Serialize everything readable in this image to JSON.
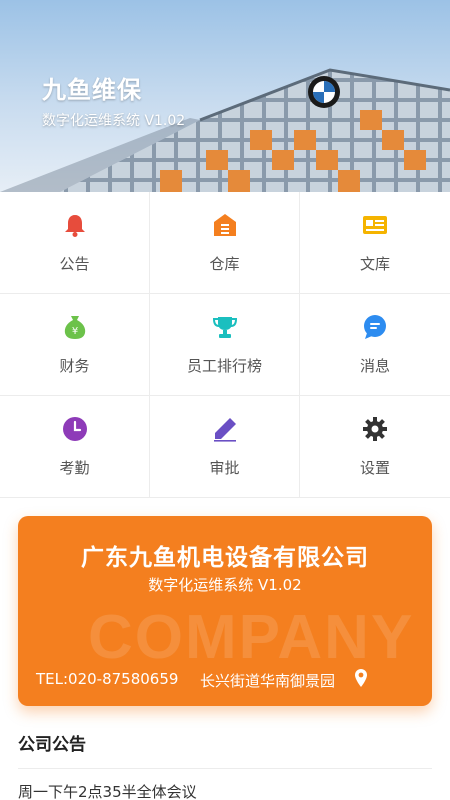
{
  "hero": {
    "title": "九鱼维保",
    "subtitle": "数字化运维系统 V1.02"
  },
  "grid": {
    "items": [
      {
        "label": "公告",
        "icon": "bell-icon",
        "color": "#e74c3c"
      },
      {
        "label": "仓库",
        "icon": "warehouse-icon",
        "color": "#f47f1f"
      },
      {
        "label": "文库",
        "icon": "library-card-icon",
        "color": "#f5b400"
      },
      {
        "label": "财务",
        "icon": "money-bag-icon",
        "color": "#6cc24a"
      },
      {
        "label": "员工排行榜",
        "icon": "trophy-icon",
        "color": "#1bbfbf"
      },
      {
        "label": "消息",
        "icon": "chat-bubble-icon",
        "color": "#2d8cf0"
      },
      {
        "label": "考勤",
        "icon": "clock-icon",
        "color": "#8e3bb8"
      },
      {
        "label": "审批",
        "icon": "pencil-icon",
        "color": "#6a4fc4"
      },
      {
        "label": "设置",
        "icon": "gear-icon",
        "color": "#333333"
      }
    ]
  },
  "card": {
    "company": "广东九鱼机电设备有限公司",
    "system": "数字化运维系统 V1.02",
    "watermark": "COMPANY",
    "tel": "TEL:020-87580659",
    "address": "长兴街道华南御景园",
    "color": "#f47f1f"
  },
  "notice": {
    "title": "公司公告",
    "items": [
      "周一下午2点35半全体会议"
    ]
  }
}
